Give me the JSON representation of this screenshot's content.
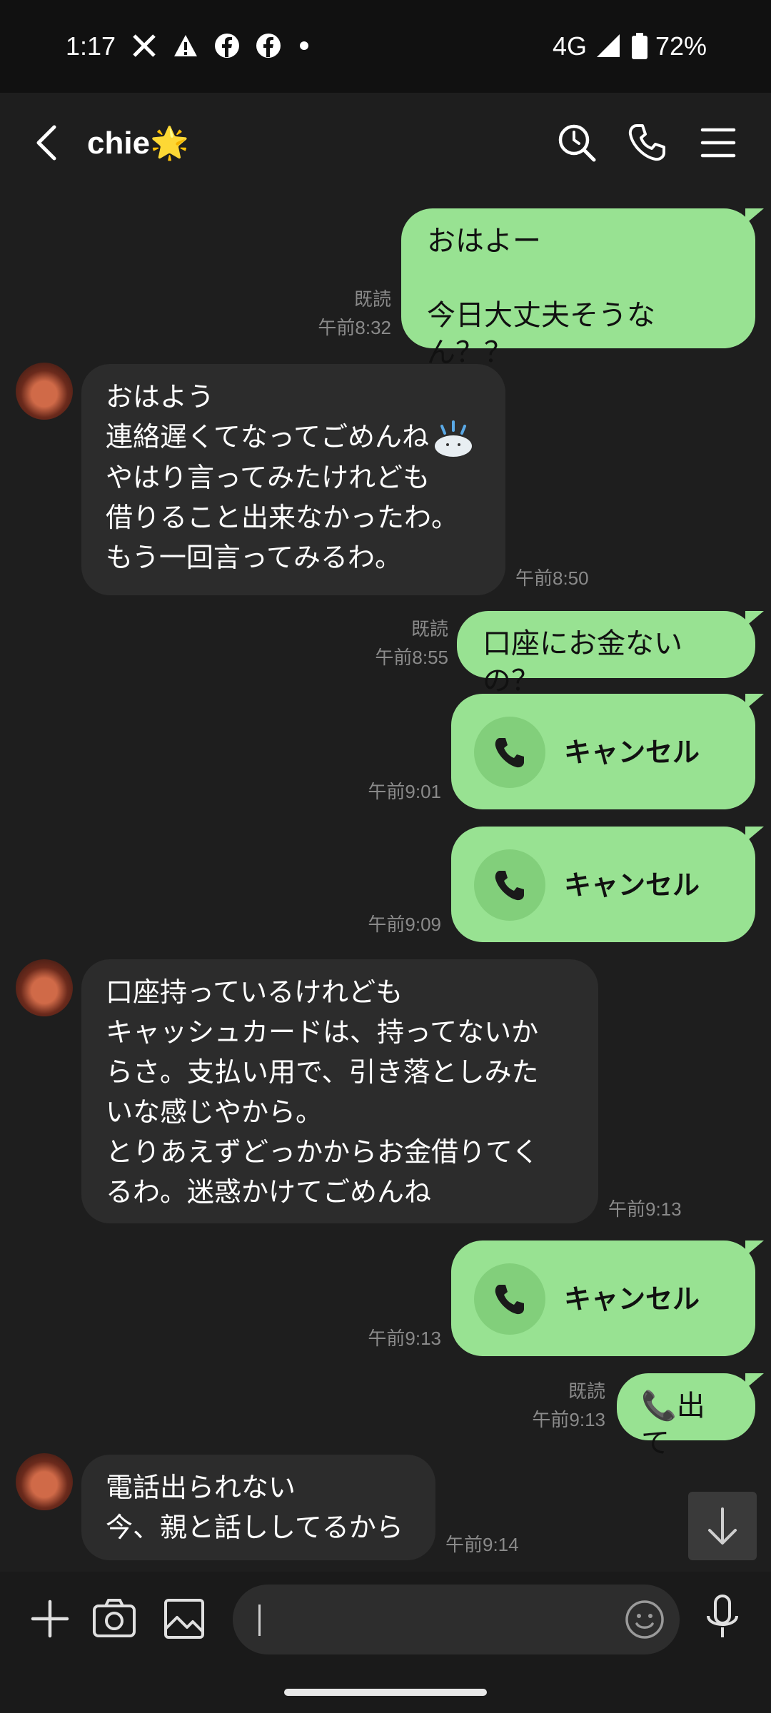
{
  "status_bar": {
    "time": "1:17",
    "network": "4G",
    "battery": "72%",
    "notification_icons": [
      "x-icon",
      "warning-icon",
      "facebook-icon",
      "facebook-icon",
      "dot-icon"
    ]
  },
  "header": {
    "title": "chie🌟",
    "icons": [
      "back-icon",
      "search-clock-icon",
      "phone-icon",
      "menu-icon"
    ]
  },
  "messages": [
    {
      "side": "out",
      "lines": [
        "おはよー",
        "",
        "今日大丈夫そうなん？？"
      ],
      "read": "既読",
      "time": "午前8:32"
    },
    {
      "side": "in",
      "lines": [
        "おはよう",
        "連絡遅くてなってごめんね",
        "やはり言ってみたけれども",
        "借りること出来なかったわ。",
        "もう一回言ってみるわ。"
      ],
      "time": "午前8:50"
    },
    {
      "side": "out",
      "lines": [
        "口座にお金ないの？"
      ],
      "read": "既読",
      "time": "午前8:55"
    },
    {
      "side": "out-call",
      "label": "キャンセル",
      "time": "午前9:01"
    },
    {
      "side": "out-call",
      "label": "キャンセル",
      "time": "午前9:09"
    },
    {
      "side": "in",
      "lines": [
        "口座持っているけれども",
        "キャッシュカードは、持ってないか",
        "らさ。支払い用で、引き落としみた",
        "いな感じやから。",
        "とりあえずどっかからお金借りてく",
        "るわ。迷惑かけてごめんね"
      ],
      "time": "午前9:13"
    },
    {
      "side": "out-call",
      "label": "キャンセル",
      "time": "午前9:13"
    },
    {
      "side": "out",
      "lines": [
        "📞出て"
      ],
      "read": "既読",
      "time": "午前9:13"
    },
    {
      "side": "in",
      "lines": [
        "電話出られない",
        "今、親と話ししてるから"
      ],
      "time": "午前9:14"
    }
  ],
  "colors": {
    "outgoing_bubble": "#98e292",
    "incoming_bubble": "#2c2c2c",
    "background": "#1e1e1e"
  },
  "input": {
    "placeholder": "",
    "icons": [
      "plus-icon",
      "camera-icon",
      "image-icon",
      "emoji-icon",
      "mic-icon"
    ]
  }
}
